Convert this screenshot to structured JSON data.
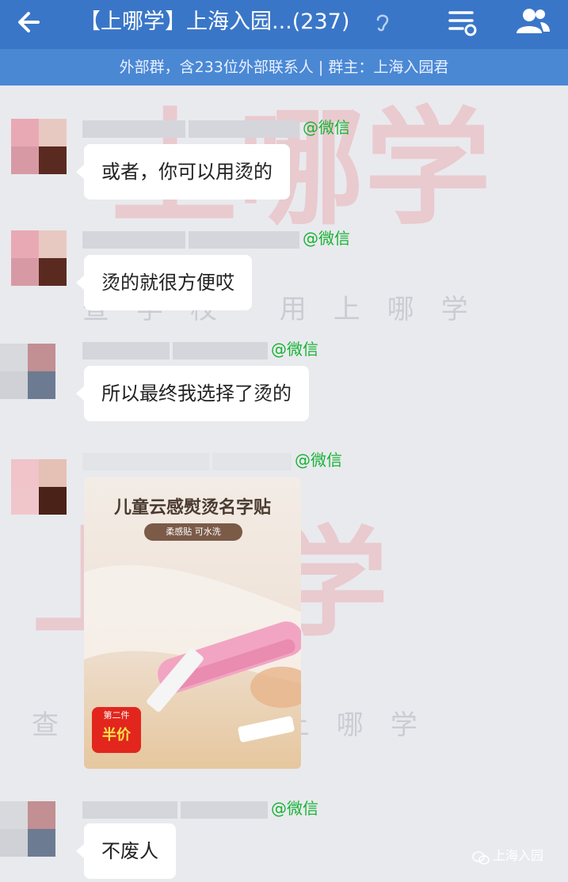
{
  "header": {
    "title": "【上哪学】上海入园...(237)",
    "subtitle": "外部群，含233位外部联系人 | 群主：上海入园君"
  },
  "messages": [
    {
      "sender_suffix": "@微信",
      "text": "或者，你可以用烫的"
    },
    {
      "sender_suffix": "@微信",
      "text": "烫的就很方便哎"
    },
    {
      "sender_suffix": "@微信",
      "text": "所以最终我选择了烫的"
    },
    {
      "sender_suffix": "@微信",
      "image": {
        "title": "儿童云感熨烫名字贴",
        "pill": "柔感贴 可水洗",
        "sale_top": "第二件",
        "sale_main": "半价"
      }
    },
    {
      "sender_suffix": "@微信",
      "text": "不废人"
    }
  ],
  "watermark": {
    "big": "上哪学",
    "line": "查学校 用上哪学"
  },
  "footer": {
    "logo_text": "上海入园"
  },
  "colors": {
    "topbar": "#3a76c8",
    "subbar": "#4a88d4",
    "sender": "#17b335"
  }
}
